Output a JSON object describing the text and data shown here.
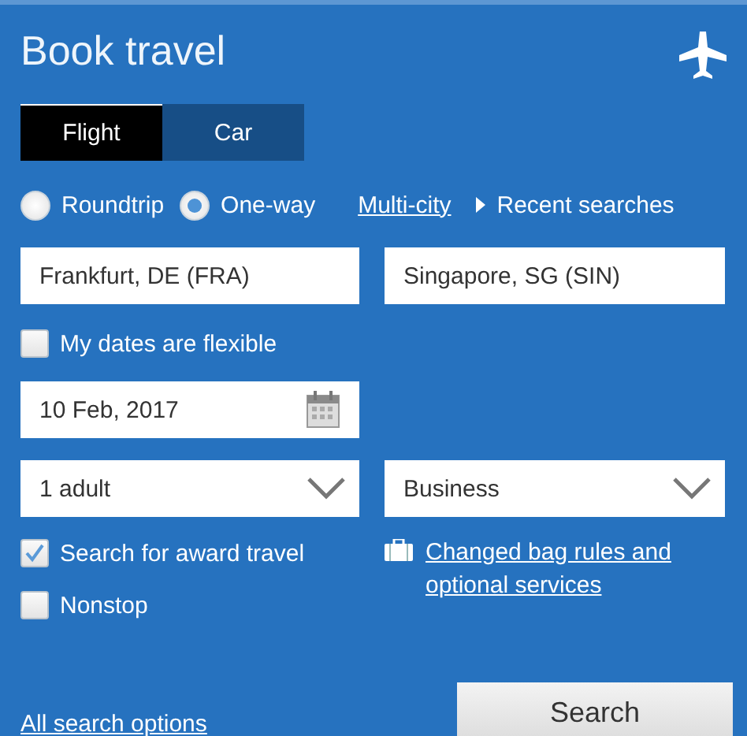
{
  "header": {
    "title": "Book travel"
  },
  "tabs": [
    {
      "label": "Flight",
      "selected": true
    },
    {
      "label": "Car",
      "selected": false
    }
  ],
  "trip_types": [
    {
      "label": "Roundtrip",
      "selected": false
    },
    {
      "label": "One-way",
      "selected": true
    }
  ],
  "multi_city_link": "Multi-city",
  "recent_searches": "Recent searches",
  "origin": {
    "value": "Frankfurt, DE (FRA)"
  },
  "destination": {
    "value": "Singapore, SG (SIN)"
  },
  "flexible_dates": {
    "label": "My dates are flexible",
    "checked": false
  },
  "date": {
    "value": "10 Feb, 2017"
  },
  "passengers": {
    "value": "1 adult"
  },
  "cabin": {
    "value": "Business"
  },
  "options": [
    {
      "label": "Search for award travel",
      "checked": true
    },
    {
      "label": "Nonstop",
      "checked": false
    }
  ],
  "bag_link": "Changed bag rules and optional services",
  "all_options_link": "All search options",
  "search_button": "Search"
}
